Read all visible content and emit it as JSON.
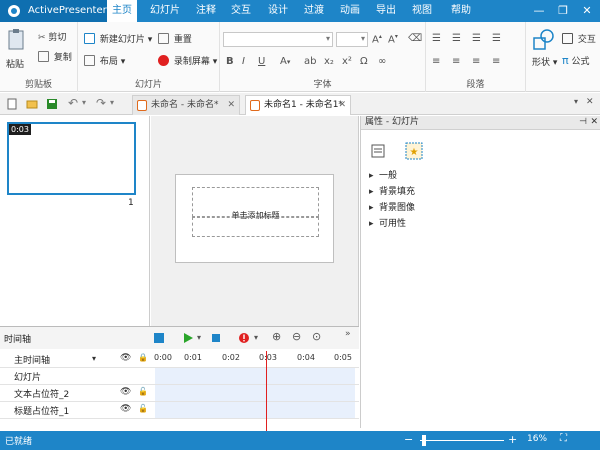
{
  "app": {
    "name": "ActivePresenter"
  },
  "tabs": [
    "主页",
    "幻灯片",
    "注释",
    "交互",
    "设计",
    "过渡",
    "动画",
    "导出",
    "视图",
    "帮助"
  ],
  "ribbon": {
    "clipboard": {
      "paste": "粘贴",
      "cut": "剪切",
      "copy": "复制",
      "label": "剪贴板"
    },
    "slides": {
      "new_slide": "新建幻灯片",
      "reset": "重置",
      "layout": "布局",
      "record_screen": "录制屏幕",
      "label": "幻灯片"
    },
    "font": {
      "label": "字体"
    },
    "paragraph": {
      "label": "段落"
    },
    "drawing": {
      "shape": "形状",
      "interaction": "交互",
      "formula": "公式"
    }
  },
  "documents": [
    {
      "title": "未命名 - 未命名*"
    },
    {
      "title": "未命名1 - 未命名1*"
    }
  ],
  "thumbnail": {
    "time": "0:03",
    "number": "1"
  },
  "slide": {
    "title_placeholder": "单击添加标题"
  },
  "properties": {
    "header": "属性 - 幻灯片",
    "sections": [
      "一般",
      "背景填充",
      "背景图像",
      "可用性"
    ]
  },
  "timeline": {
    "title": "时间轴",
    "ticks": [
      "0:00",
      "0:01",
      "0:02",
      "0:03",
      "0:04",
      "0:05"
    ],
    "rows": [
      "主时间轴",
      "幻灯片",
      "文本占位符_2",
      "标题占位符_1"
    ]
  },
  "status": {
    "text": "已就绪",
    "zoom": "16%",
    "zoom_level": 0.16
  },
  "colors": {
    "accent": "#1e85c8",
    "record": "#e02020",
    "play": "#2aa52a"
  }
}
